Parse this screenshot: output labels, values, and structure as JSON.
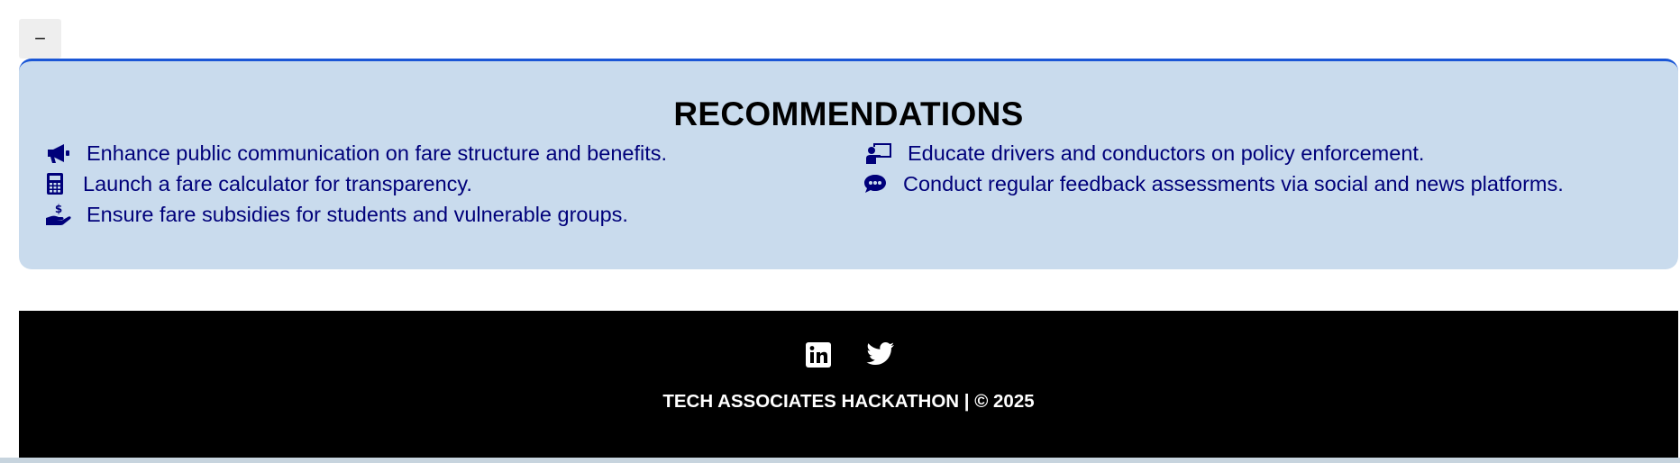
{
  "collapse_button": {
    "label": "−"
  },
  "recommendations": {
    "title": "RECOMMENDATIONS",
    "items": [
      {
        "icon": "megaphone-icon",
        "text": "Enhance public communication on fare structure and benefits."
      },
      {
        "icon": "calculator-icon",
        "text": "Launch a fare calculator for transparency."
      },
      {
        "icon": "hand-holding-dollar-icon",
        "text": "Ensure fare subsidies for students and vulnerable groups."
      },
      {
        "icon": "chalkboard-teacher-icon",
        "text": "Educate drivers and conductors on policy enforcement."
      },
      {
        "icon": "comment-dots-icon",
        "text": "Conduct regular feedback assessments via social and news platforms."
      }
    ]
  },
  "footer": {
    "social": [
      {
        "icon": "linkedin-icon",
        "label": "LinkedIn"
      },
      {
        "icon": "twitter-icon",
        "label": "Twitter"
      }
    ],
    "text": "TECH ASSOCIATES HACKATHON | © 2025"
  },
  "colors": {
    "panel_background": "#c9dbed",
    "panel_border": "#1a56d6",
    "item_text": "#00007a",
    "footer_background": "#000000"
  }
}
